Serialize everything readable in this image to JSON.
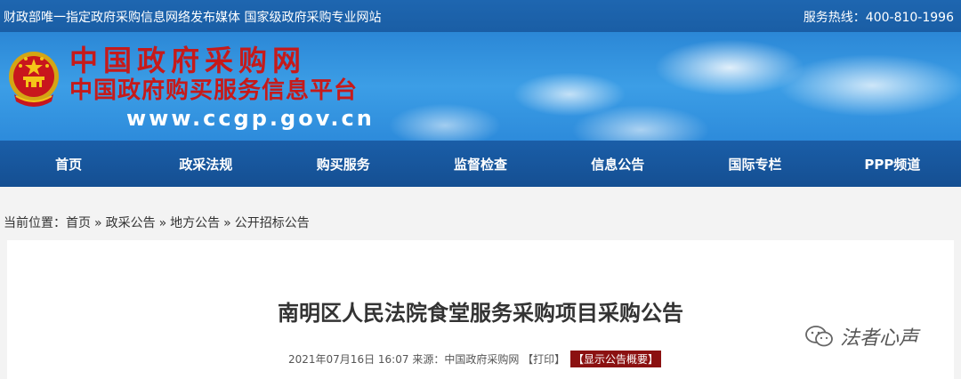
{
  "topbar": {
    "left_text": "财政部唯一指定政府采购信息网络发布媒体 国家级政府采购专业网站",
    "hotline": "服务热线：400-810-1996"
  },
  "banner": {
    "title_main": "中国政府采购网",
    "title_sub": "中国政府购买服务信息平台",
    "url": "www.ccgp.gov.cn"
  },
  "nav": {
    "items": [
      "首页",
      "政采法规",
      "购买服务",
      "监督检查",
      "信息公告",
      "国际专栏",
      "PPP频道"
    ]
  },
  "breadcrumb": {
    "label": "当前位置：",
    "items": [
      "首页",
      "政采公告",
      "地方公告",
      "公开招标公告"
    ],
    "separator": "»"
  },
  "article": {
    "title": "南明区人民法院食堂服务采购项目采购公告",
    "date": "2021年07月16日 16:07",
    "source_label": "来源：",
    "source": "中国政府采购网",
    "print": "【打印】",
    "summary_button": "【显示公告概要】"
  },
  "watermark": {
    "text": "法者心声"
  },
  "colors": {
    "topbar_bg": "#1e66b0",
    "nav_bg": "#1a5ea8",
    "brand_red": "#c61a1a",
    "summary_btn_bg": "#8b1111"
  }
}
